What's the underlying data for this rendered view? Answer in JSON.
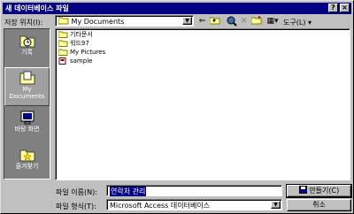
{
  "window": {
    "title": "새 데이터베이스 파일"
  },
  "titlebar_buttons": {
    "help": "?",
    "close": "×"
  },
  "location": {
    "label": "저장 위치(I):",
    "value": "My Documents"
  },
  "toolbar": {
    "tools_menu": "도구(L)"
  },
  "places": [
    {
      "label": "기록"
    },
    {
      "label": "My Documents"
    },
    {
      "label": "바탕 화면"
    },
    {
      "label": "즐겨찾기"
    }
  ],
  "files": [
    {
      "name": "기타문서",
      "type": "folder"
    },
    {
      "name": "워드97",
      "type": "folder"
    },
    {
      "name": "My Pictures",
      "type": "folder"
    },
    {
      "name": "sample",
      "type": "database"
    }
  ],
  "filename": {
    "label": "파일 이름(N):",
    "value": "연락처 관리"
  },
  "filetype": {
    "label": "파일 형식(T):",
    "value": "Microsoft Access 데이터베이스"
  },
  "buttons": {
    "create": "만들기(C)",
    "cancel": "취소"
  },
  "colors": {
    "titlebar": "#000080",
    "face": "#c0c0c0",
    "selection": "#000080",
    "folder": "#ffff99"
  }
}
